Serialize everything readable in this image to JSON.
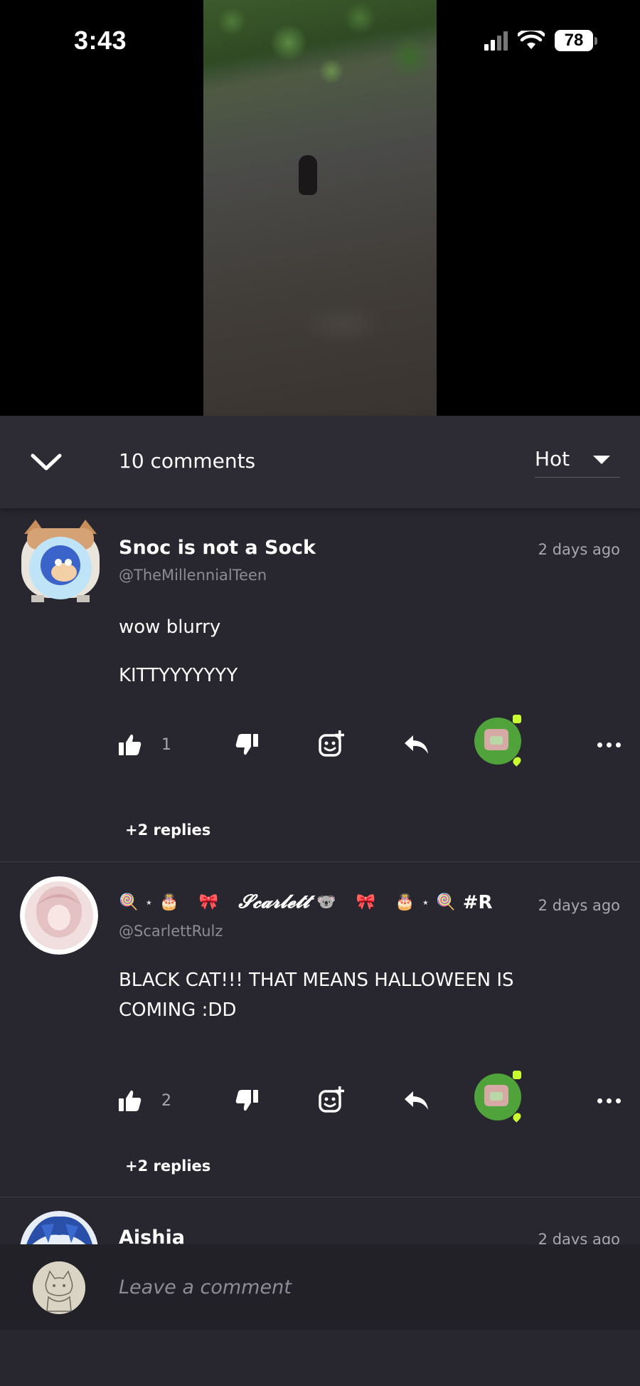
{
  "status_bar": {
    "time": "3:43",
    "battery": "78"
  },
  "header": {
    "comment_count": "10 comments",
    "sort_label": "Hot"
  },
  "comments": [
    {
      "name": "Snoc is not a Sock",
      "handle": "@TheMillennialTeen",
      "time": "2 days ago",
      "lines": [
        "wow blurry",
        "KITTYYYYYYY"
      ],
      "likes": "1",
      "replies": "+2 replies"
    },
    {
      "name_parts": [
        "🍭",
        "⋆",
        "🎂",
        "🎀",
        "𝓢𝓬𝓪𝓻𝓵𝓮𝓽𝓽",
        "🐨",
        "🎀",
        "🎂",
        "⋆",
        "🍭",
        "#R"
      ],
      "handle": "@ScarlettRulz",
      "time": "2 days ago",
      "lines": [
        "BLACK CAT!!! THAT MEANS HALLOWEEN IS COMING :DD"
      ],
      "likes": "2",
      "replies": "+2 replies"
    },
    {
      "name": "Aishia",
      "time": "2 days ago"
    }
  ],
  "composer": {
    "placeholder": "Leave a comment"
  },
  "colors": {
    "background": "#28262f",
    "header": "#2d2b34",
    "reward_green": "#4fa33a",
    "accent_lime": "#c8ff2e"
  }
}
